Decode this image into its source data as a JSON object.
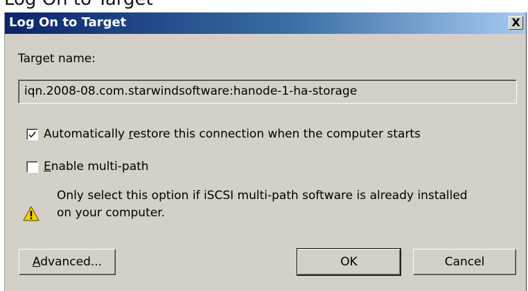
{
  "cropped_title": "Log On to Target",
  "window": {
    "title": "Log On to Target",
    "close_glyph": "X"
  },
  "target_name_label": "Target name:",
  "target_name_value": "iqn.2008-08.com.starwindsoftware:hanode-1-ha-storage",
  "checkboxes": {
    "auto_restore": {
      "label_before": "Automatically ",
      "label_accel": "r",
      "label_after": "estore this connection when the computer starts",
      "checked": true
    },
    "multipath": {
      "label_before": "",
      "label_accel": "E",
      "label_after": "nable multi-path",
      "checked": false
    }
  },
  "warning": {
    "icon": "warning-icon",
    "line1": "Only select this option if iSCSI multi-path software is already installed",
    "line2": "on your computer."
  },
  "buttons": {
    "advanced": {
      "accel": "A",
      "rest": "dvanced..."
    },
    "ok": "OK",
    "cancel": "Cancel"
  }
}
